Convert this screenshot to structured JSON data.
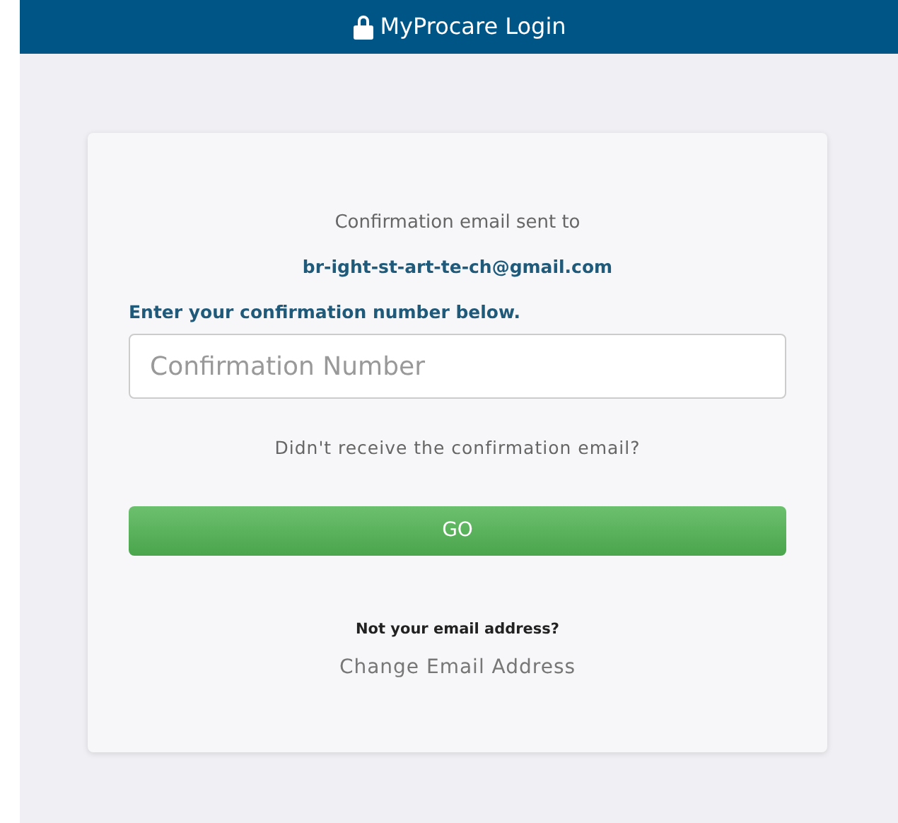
{
  "header": {
    "title": "MyProcare Login"
  },
  "card": {
    "sent_label": "Confirmation email sent to",
    "email": "br-ight-st-art-te-ch@gmail.com",
    "instruction": "Enter your confirmation number below.",
    "field": {
      "placeholder": "Confirmation Number"
    },
    "resend_link": "Didn't receive the confirmation email?",
    "submit_button": "GO",
    "not_your_email": "Not your email address?",
    "change_email_link": "Change Email Address"
  }
}
